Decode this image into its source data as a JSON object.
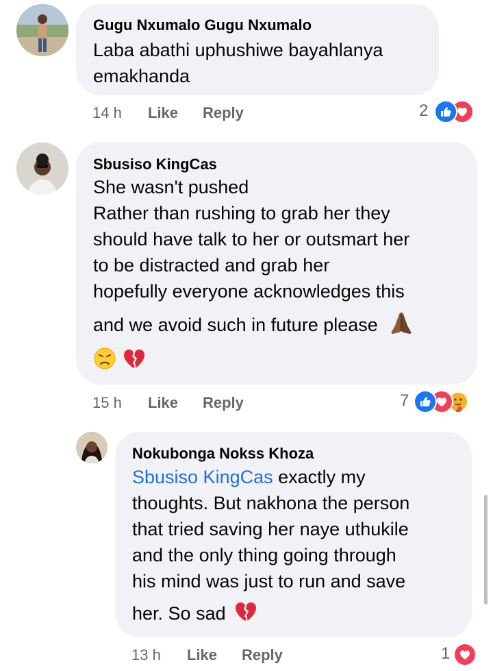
{
  "comments": [
    {
      "author": "Gugu Nxumalo Gugu Nxumalo",
      "lines": [
        "Laba abathi uphushiwe bayahlanya",
        "emakhanda"
      ],
      "time": "14 h",
      "like_label": "Like",
      "reply_label": "Reply",
      "reaction_count": "2",
      "reactions": [
        "like-reaction-icon",
        "love-reaction-icon"
      ]
    },
    {
      "author": "Sbusiso KingCas",
      "lines": [
        "She wasn't pushed",
        "Rather than rushing to grab her they",
        "should have talk to her or outsmart her",
        "to be distracted and grab her",
        "hopefully everyone acknowledges this",
        "and we avoid such in future please"
      ],
      "time": "15 h",
      "like_label": "Like",
      "reply_label": "Reply",
      "reaction_count": "7",
      "reactions": [
        "like-reaction-icon",
        "love-reaction-icon",
        "care-reaction-icon"
      ]
    }
  ],
  "reply": {
    "author": "Nokubonga Nokss Khoza",
    "mention": "Sbusiso KingCas",
    "first_line_rest": " exactly my",
    "lines": [
      "thoughts. But nakhona the person",
      "that tried saving her naye uthukile",
      "and the only thing going through",
      "his mind was just to run and save"
    ],
    "last_line": "her. So sad",
    "time": "13 h",
    "like_label": "Like",
    "reply_label": "Reply",
    "reaction_count": "1",
    "reactions": [
      "love-reaction-icon"
    ]
  },
  "colors": {
    "bubble": "#f0f2f5",
    "like_blue": "#1877f2",
    "love_red": "#f33e58",
    "mention_blue": "#216fdb",
    "meta_gray": "#65676b"
  }
}
